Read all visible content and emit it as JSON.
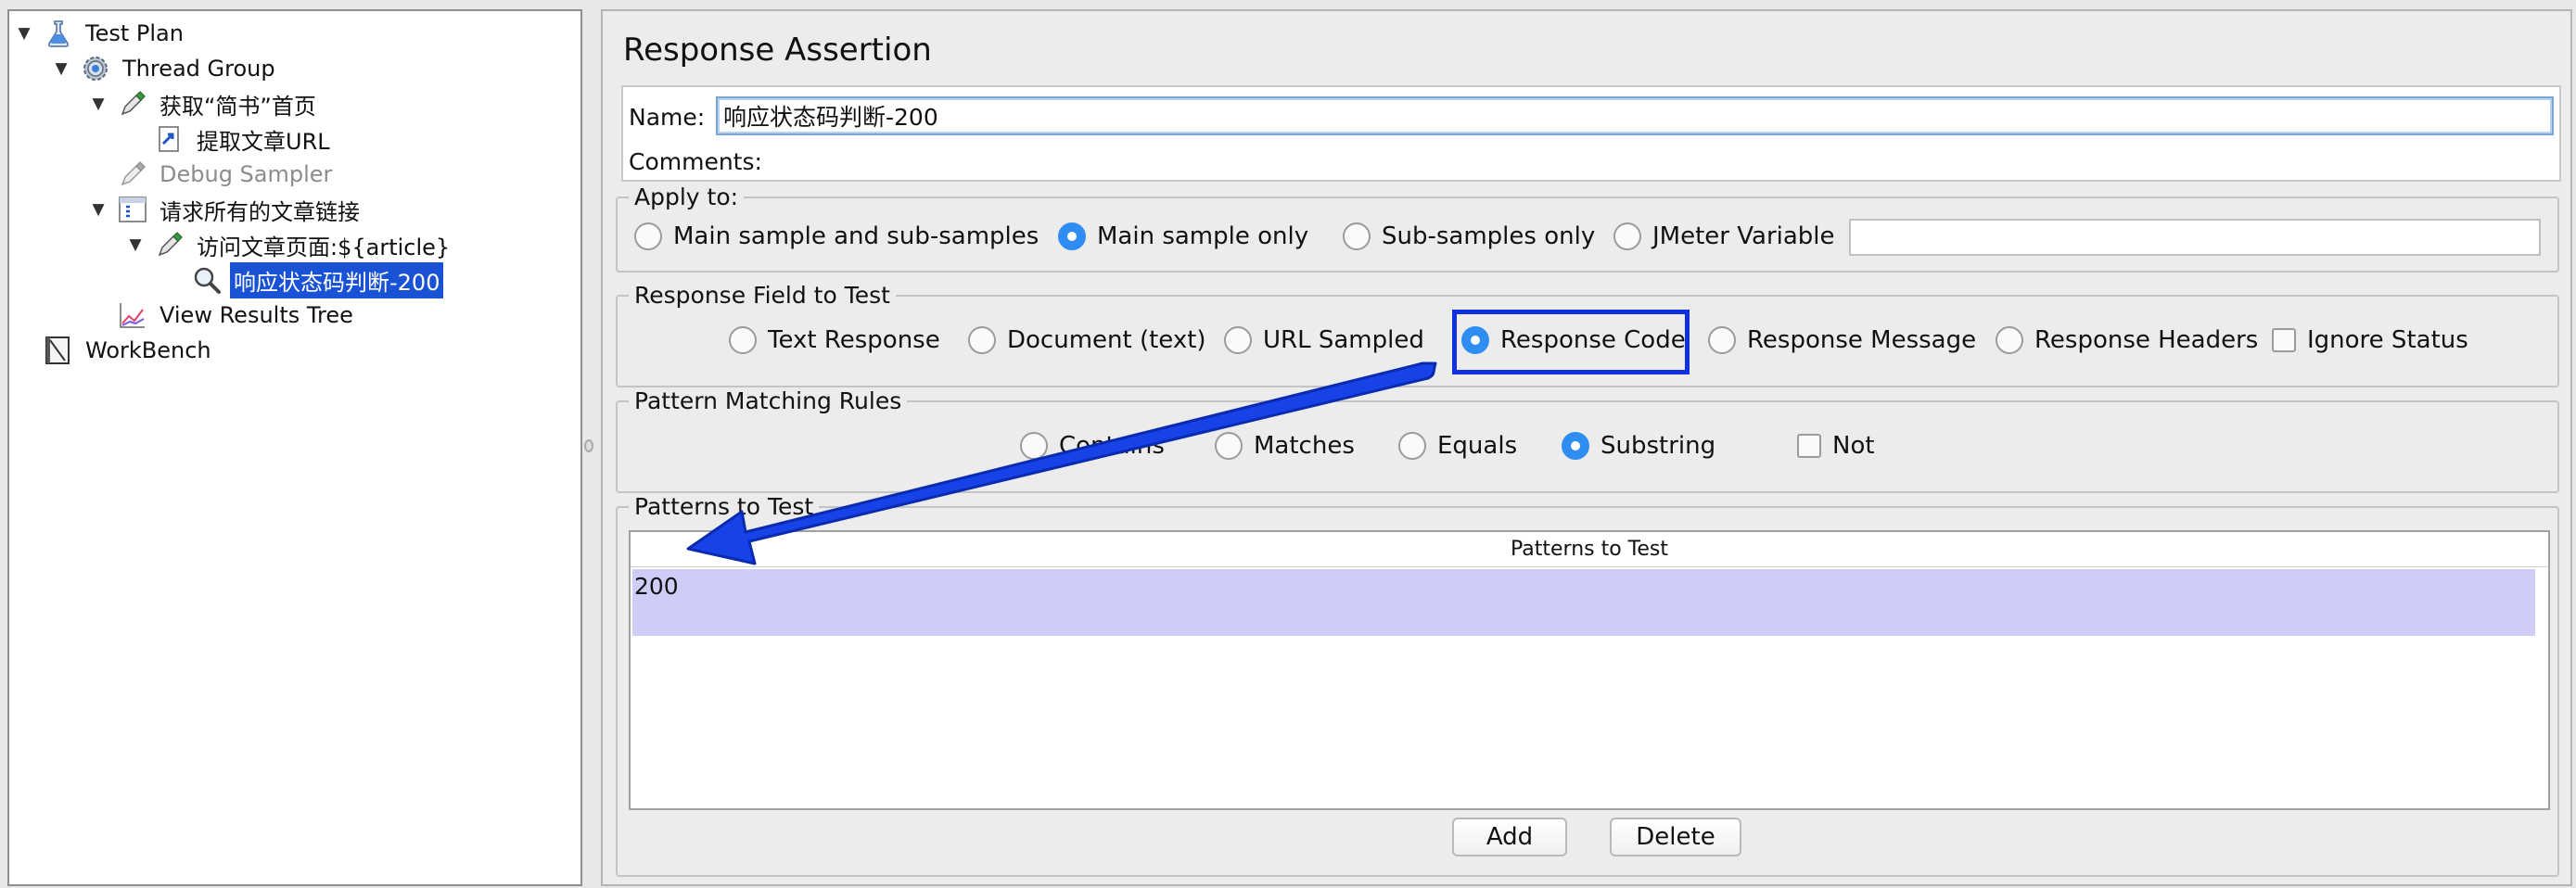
{
  "tree": {
    "items": [
      {
        "label": "Test Plan",
        "icon": "flask-icon",
        "expanded": true
      },
      {
        "label": "Thread Group",
        "icon": "gear-icon",
        "expanded": true
      },
      {
        "label": "获取“简书”首页",
        "icon": "pipette-icon",
        "expanded": true
      },
      {
        "label": "提取文章URL",
        "icon": "extractor-icon"
      },
      {
        "label": "Debug Sampler",
        "icon": "pipette-icon",
        "disabled": true
      },
      {
        "label": "请求所有的文章链接",
        "icon": "controller-icon",
        "expanded": true
      },
      {
        "label": "访问文章页面:${article}",
        "icon": "pipette-icon",
        "expanded": true
      },
      {
        "label": "响应状态码判断-200",
        "icon": "magnifier-icon",
        "selected": true
      },
      {
        "label": "View Results Tree",
        "icon": "chart-icon"
      },
      {
        "label": "WorkBench",
        "icon": "workbench-icon"
      }
    ]
  },
  "assertion": {
    "title": "Response Assertion",
    "name_label": "Name:",
    "name_value": "响应状态码判断-200",
    "comments_label": "Comments:"
  },
  "apply_to": {
    "title": "Apply to:",
    "options": [
      {
        "label": "Main sample and sub-samples",
        "checked": false
      },
      {
        "label": "Main sample only",
        "checked": true
      },
      {
        "label": "Sub-samples only",
        "checked": false
      },
      {
        "label": "JMeter Variable",
        "checked": false
      }
    ],
    "variable_value": ""
  },
  "response_field": {
    "title": "Response Field to Test",
    "options": [
      {
        "label": "Text Response",
        "checked": false
      },
      {
        "label": "Document (text)",
        "checked": false
      },
      {
        "label": "URL Sampled",
        "checked": false
      },
      {
        "label": "Response Code",
        "checked": true
      },
      {
        "label": "Response Message",
        "checked": false
      },
      {
        "label": "Response Headers",
        "checked": false
      }
    ],
    "ignore_status": {
      "label": "Ignore Status",
      "checked": false
    }
  },
  "pattern_rules": {
    "title": "Pattern Matching Rules",
    "options": [
      {
        "label": "Contains",
        "checked": false
      },
      {
        "label": "Matches",
        "checked": false
      },
      {
        "label": "Equals",
        "checked": false
      },
      {
        "label": "Substring",
        "checked": true
      }
    ],
    "not": {
      "label": "Not",
      "checked": false
    }
  },
  "patterns": {
    "title": "Patterns to Test",
    "column_header": "Patterns to Test",
    "rows": [
      "200"
    ],
    "add_label": "Add",
    "delete_label": "Delete"
  },
  "colors": {
    "selection": "#1a52d6",
    "radio_checked": "#2f8df2",
    "annotation": "#1030e0",
    "table_row": "#cdcdf8"
  }
}
